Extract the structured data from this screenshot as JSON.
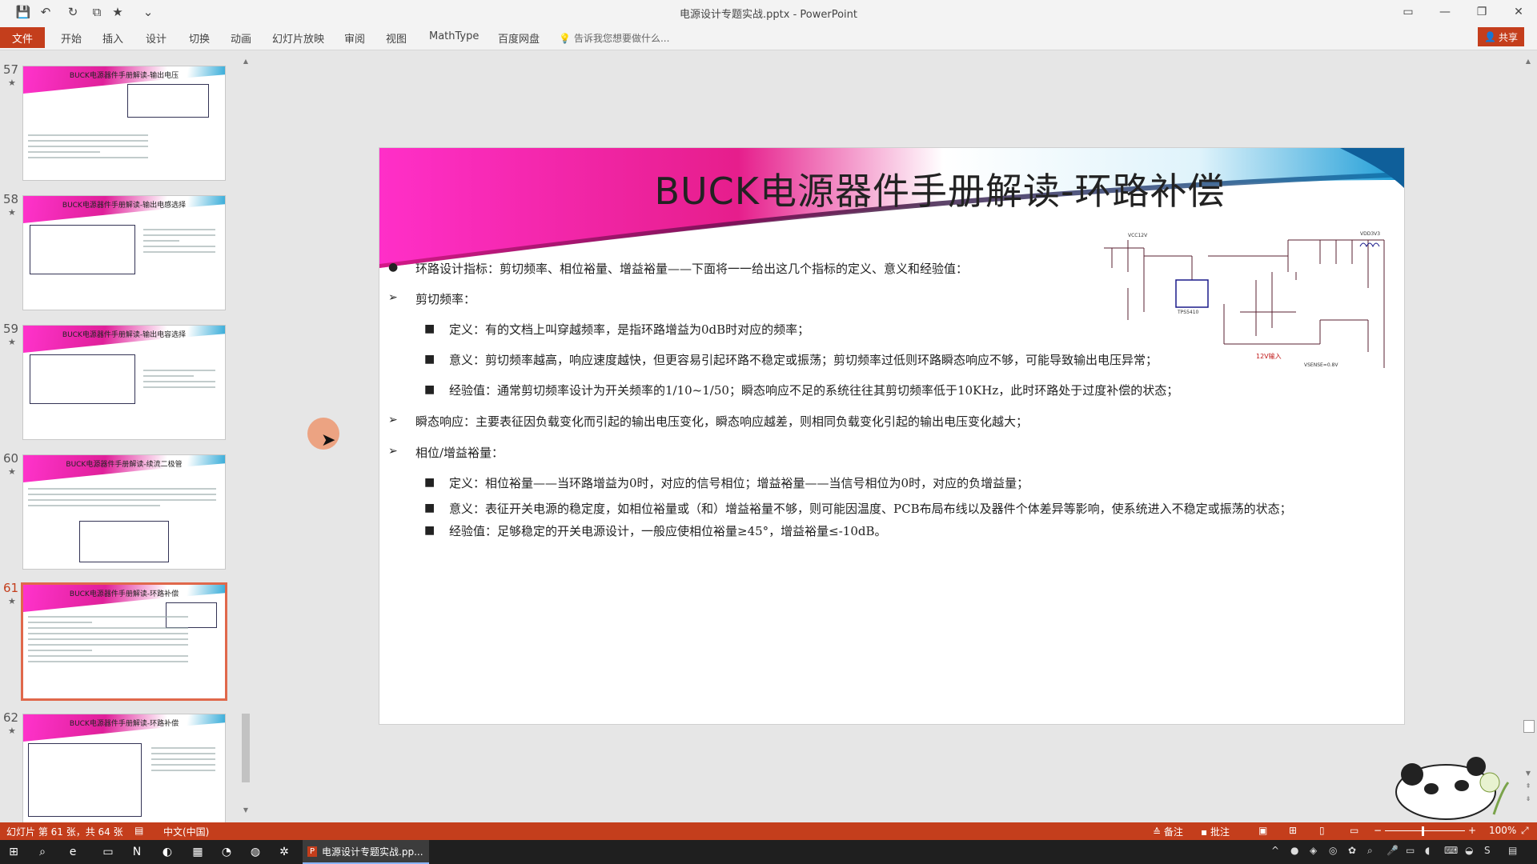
{
  "window": {
    "title": "电源设计专题实战.pptx - PowerPoint",
    "minimize": "—",
    "maximize": "❐",
    "close": "✕"
  },
  "ribbon": {
    "file_tab": "文件",
    "tabs": [
      "开始",
      "插入",
      "设计",
      "切换",
      "动画",
      "幻灯片放映",
      "审阅",
      "视图",
      "MathType",
      "百度网盘"
    ],
    "tell_me": "告诉我您想要做什么...",
    "share": "共享"
  },
  "thumbnails": [
    {
      "number": "57",
      "star": "★",
      "title": "BUCK电源器件手册解读-输出电压"
    },
    {
      "number": "58",
      "star": "★",
      "title": "BUCK电源器件手册解读-输出电感选择"
    },
    {
      "number": "59",
      "star": "★",
      "title": "BUCK电源器件手册解读-输出电容选择"
    },
    {
      "number": "60",
      "star": "★",
      "title": "BUCK电源器件手册解读-续流二极管"
    },
    {
      "number": "61",
      "star": "★",
      "title": "BUCK电源器件手册解读-环路补偿"
    },
    {
      "number": "62",
      "star": "★",
      "title": "BUCK电源器件手册解读-环路补偿"
    }
  ],
  "slide": {
    "title": "BUCK电源器件手册解读-环路补偿",
    "bullet_dot": "●",
    "bullet_arrow": "➢",
    "bullet_square": "■",
    "lines": [
      "环路设计指标：剪切频率、相位裕量、增益裕量——下面将一一给出这几个指标的定义、意义和经验值：",
      "剪切频率：",
      "定义：有的文档上叫穿越频率，是指环路增益为0dB时对应的频率；",
      "意义：剪切频率越高，响应速度越快，但更容易引起环路不稳定或振荡；剪切频率过低则环路瞬态响应不够，可能导致输出电压异常；",
      "经验值：通常剪切频率设计为开关频率的1/10~1/50；瞬态响应不足的系统往往其剪切频率低于10KHz，此时环路处于过度补偿的状态；",
      "瞬态响应：主要表征因负载变化而引起的输出电压变化，瞬态响应越差，则相同负载变化引起的输出电压变化越大；",
      "相位/增益裕量：",
      "定义：相位裕量——当环路增益为0时，对应的信号相位；增益裕量——当信号相位为0时，对应的负增益量；",
      "意义：表征开关电源的稳定度，如相位裕量或（和）增益裕量不够，则可能因温度、PCB布局布线以及器件个体差异等影响，使系统进入不稳定或振荡的状态；",
      "经验值：足够稳定的开关电源设计，一般应使相位裕量≥45°，增益裕量≤-10dB。"
    ],
    "schematic_label_input": "12V输入",
    "schematic_label_vcc": "VCC12V",
    "schematic_label_out": "VDD3V3",
    "schematic_label_sense": "VSENSE=0.8V",
    "schematic_chip": "TPS5410"
  },
  "statusbar": {
    "slide_info": "幻灯片 第 61 张，共 64 张",
    "language": "中文(中国)",
    "notes": "备注",
    "comments": "批注",
    "zoom": "100%"
  },
  "taskbar": {
    "app_label": "电源设计专题实战.pp...",
    "start": "⊞"
  },
  "colors": {
    "accent": "#c43e1c",
    "banner_pink": "#ff2fc8",
    "banner_blue": "#1a9bd6"
  }
}
